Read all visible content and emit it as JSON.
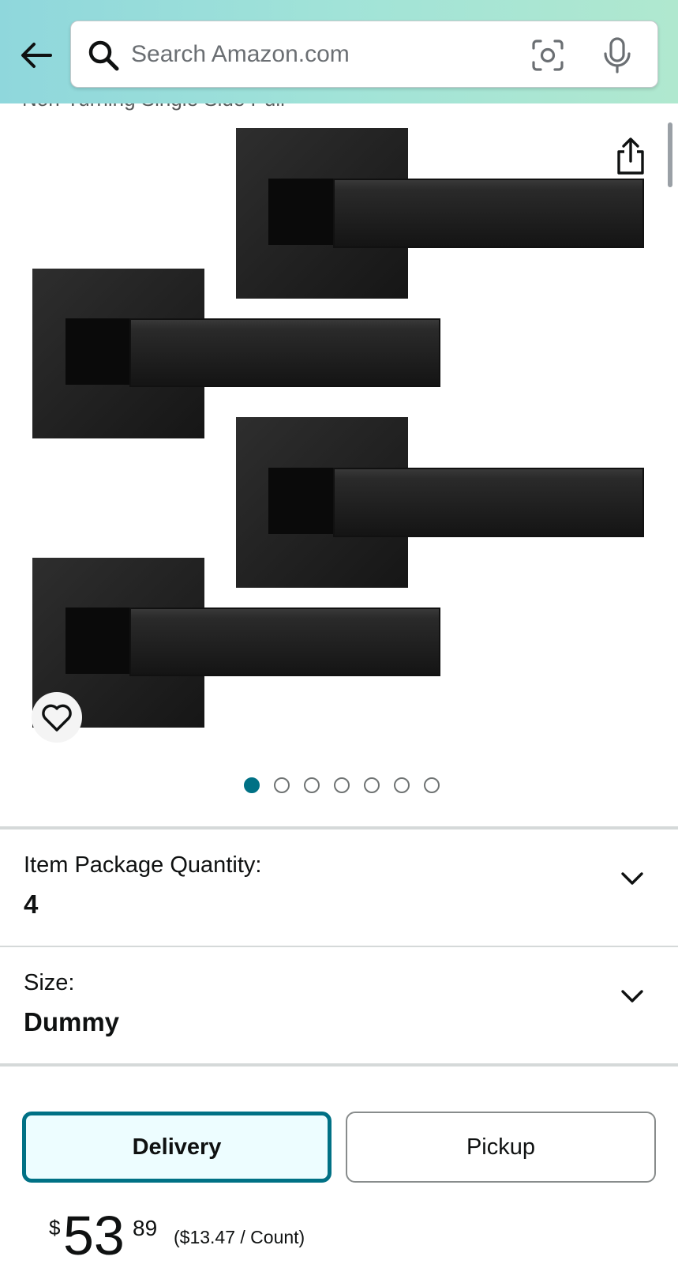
{
  "header": {
    "search_placeholder": "Search Amazon.com",
    "icons": [
      "back-arrow-icon",
      "search-icon",
      "camera-icon",
      "microphone-icon"
    ],
    "background_colors": [
      "#8fd7dc",
      "#b0e8cf"
    ]
  },
  "product": {
    "title_partial": "Non-Turning Single Side Pull"
  },
  "gallery": {
    "image_count": 7,
    "active_index": 0,
    "icons": [
      "share-icon",
      "heart-icon"
    ]
  },
  "options": [
    {
      "label": "Item Package Quantity:",
      "value": "4"
    },
    {
      "label": "Size:",
      "value": "Dummy"
    }
  ],
  "fulfillment": {
    "delivery_label": "Delivery",
    "pickup_label": "Pickup",
    "selected": "Delivery"
  },
  "price": {
    "symbol": "$",
    "whole": "53",
    "fraction": "89",
    "per_unit": "($13.47 / Count)"
  },
  "colors": {
    "accent": "#007185",
    "selected_bg": "#edfdff",
    "text": "#0f1111"
  }
}
